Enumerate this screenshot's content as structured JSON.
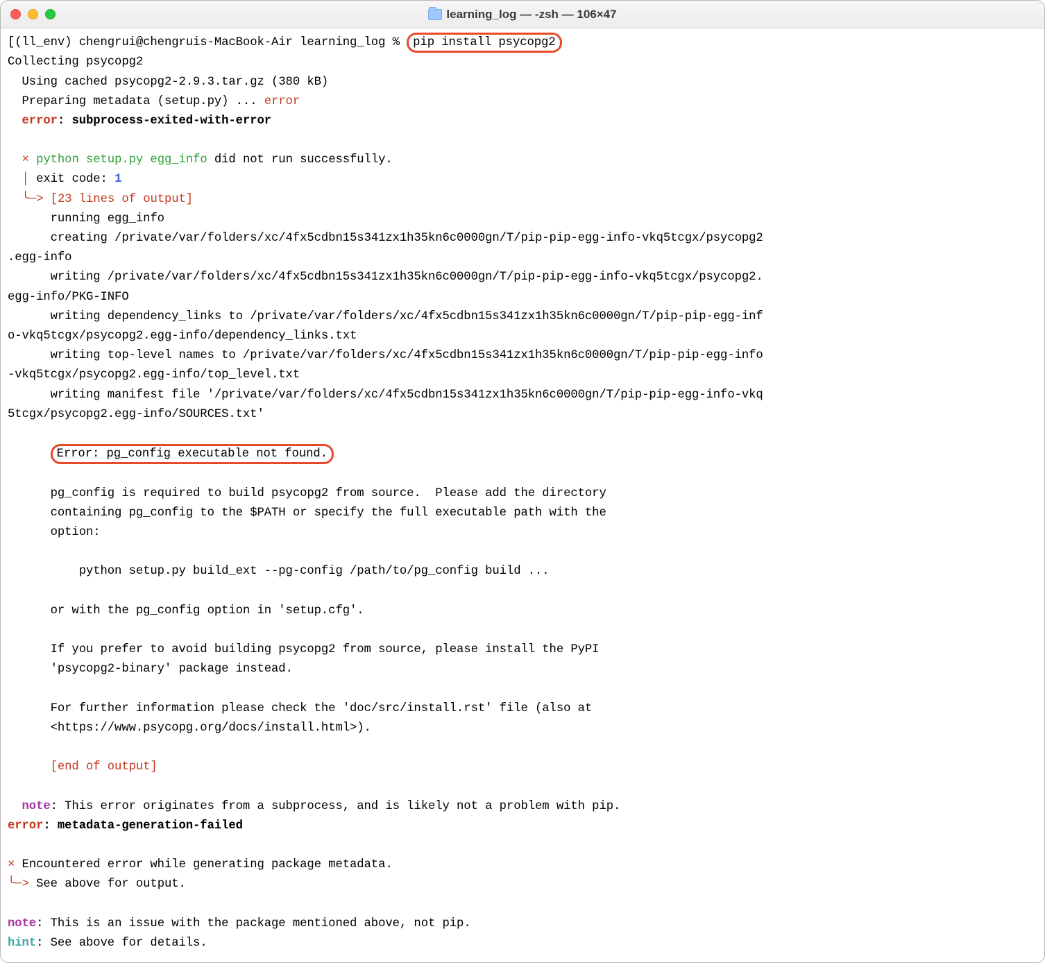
{
  "window": {
    "title": "learning_log — -zsh — 106×47"
  },
  "prompt": {
    "prefix": "[(ll_env) chengrui@chengruis-MacBook-Air learning_log % ",
    "command": "pip install psycopg2"
  },
  "lines": {
    "collecting": "Collecting psycopg2",
    "cached": "  Using cached psycopg2-2.9.3.tar.gz (380 kB)",
    "preparing": "  Preparing metadata (setup.py) ... ",
    "prep_err": "error",
    "err_lbl": "  error",
    "err_msg": ": subprocess-exited-with-error",
    "x1": "  × ",
    "egg_cmd": "python setup.py egg_info",
    "egg_tail": " did not run successfully.",
    "bar1": "  │ ",
    "exit_lbl": "exit code: ",
    "exit_code": "1",
    "arrow1": "  ╰─> ",
    "out23": "[23 lines of output]",
    "o1": "      running egg_info",
    "o2": "      creating /private/var/folders/xc/4fx5cdbn15s341zx1h35kn6c0000gn/T/pip-pip-egg-info-vkq5tcgx/psycopg2\n.egg-info",
    "o3": "      writing /private/var/folders/xc/4fx5cdbn15s341zx1h35kn6c0000gn/T/pip-pip-egg-info-vkq5tcgx/psycopg2.\negg-info/PKG-INFO",
    "o4": "      writing dependency_links to /private/var/folders/xc/4fx5cdbn15s341zx1h35kn6c0000gn/T/pip-pip-egg-inf\no-vkq5tcgx/psycopg2.egg-info/dependency_links.txt",
    "o5": "      writing top-level names to /private/var/folders/xc/4fx5cdbn15s341zx1h35kn6c0000gn/T/pip-pip-egg-info\n-vkq5tcgx/psycopg2.egg-info/top_level.txt",
    "o6": "      writing manifest file '/private/var/folders/xc/4fx5cdbn15s341zx1h35kn6c0000gn/T/pip-pip-egg-info-vkq\n5tcgx/psycopg2.egg-info/SOURCES.txt'",
    "hl2_pad": "      ",
    "hl2": "Error: pg_config executable not found.",
    "o8": "      pg_config is required to build psycopg2 from source.  Please add the directory",
    "o9": "      containing pg_config to the $PATH or specify the full executable path with the",
    "o10": "      option:",
    "o11": "          python setup.py build_ext --pg-config /path/to/pg_config build ...",
    "o12": "      or with the pg_config option in 'setup.cfg'.",
    "o13": "      If you prefer to avoid building psycopg2 from source, please install the PyPI",
    "o14": "      'psycopg2-binary' package instead.",
    "o15": "      For further information please check the 'doc/src/install.rst' file (also at",
    "o16": "      <https://www.psycopg.org/docs/install.html>).",
    "endout": "      [end of output]",
    "note1_lbl": "  note",
    "note1_txt": ": This error originates from a subprocess, and is likely not a problem with pip.",
    "err2_lbl": "error",
    "err2_txt": ": metadata-generation-failed",
    "x2": "× ",
    "enc": "Encountered error while generating package metadata.",
    "arrow2": "╰─> ",
    "seeabove": "See above for output.",
    "note2_lbl": "note",
    "note2_txt": ": This is an issue with the package mentioned above, not pip.",
    "hint_lbl": "hint",
    "hint_txt": ": See above for details."
  }
}
